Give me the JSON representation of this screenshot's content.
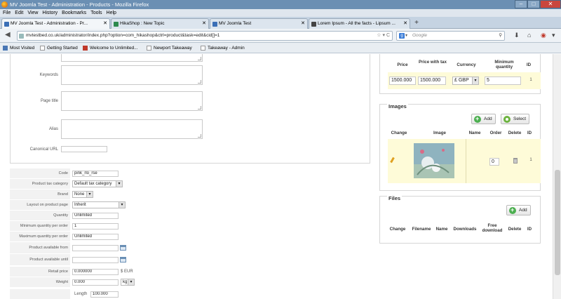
{
  "window": {
    "title": "MV Joomla Test - Administration - Products - Mozilla Firefox",
    "buttons": {
      "minimize": "–",
      "maximize": "□",
      "close": "✕"
    }
  },
  "menu": [
    "File",
    "Edit",
    "View",
    "History",
    "Bookmarks",
    "Tools",
    "Help"
  ],
  "tabs": [
    {
      "label": "MV Joomla Test - Administration - Pr...",
      "close": "✕"
    },
    {
      "label": "HikaShop : New Topic",
      "close": "✕"
    },
    {
      "label": "MV Joomla Test",
      "close": "✕"
    },
    {
      "label": "Lorem Ipsum - All the facts - Lipsum ...",
      "close": "✕"
    }
  ],
  "newtab": "+",
  "nav": {
    "back": "◀",
    "url": "mvtestbed.co.uk/administrator/index.php?option=com_hikashop&ctrl=product&task=edit&cid[]=1",
    "url_controls": "☆ ▾ C",
    "search_placeholder": "Google",
    "search_engine": "g",
    "search_dropdown": "▾",
    "search_glass": "⚲",
    "download_icon": "⬇",
    "home_icon": "⌂",
    "addon_icon": "◉",
    "menu_icon": "▾"
  },
  "bookmarks": [
    "Most Visited",
    "Getting Started",
    "Welcome to Unlimited...",
    "Newport Takeaway",
    "Takeaway - Admin"
  ],
  "seo": {
    "keywords_label": "Keywords",
    "page_title_label": "Page title",
    "alias_label": "Alias",
    "canonical_label": "Canonical URL"
  },
  "properties": {
    "code": {
      "label": "Code",
      "value": "pink_rlo_rse"
    },
    "tax_category": {
      "label": "Product tax category",
      "value": "Default tax category"
    },
    "brand": {
      "label": "Brand",
      "value": "None"
    },
    "layout": {
      "label": "Layout on product page",
      "value": "Inherit"
    },
    "quantity": {
      "label": "Quantity",
      "value": "Unlimited"
    },
    "min_qty": {
      "label": "Minimum quantity per order",
      "value": "1"
    },
    "max_qty": {
      "label": "Maximum quantity per order",
      "value": "Unlimited"
    },
    "available_from": {
      "label": "Product available from",
      "value": ""
    },
    "available_until": {
      "label": "Product available until",
      "value": ""
    },
    "retail_price": {
      "label": "Retail price",
      "value": "0.000000",
      "currency": "$ EUR"
    },
    "weight": {
      "label": "Weight",
      "value": "0.000",
      "unit": "kg"
    },
    "length": {
      "label": "Length",
      "value": "100.000"
    }
  },
  "prices": {
    "headers": [
      "Price",
      "Price with tax",
      "Currency",
      "Minimum quantity",
      "ID"
    ],
    "row": {
      "price": "1500.000",
      "price_tax": "1500.000",
      "currency": "£ GBP",
      "min_qty": "5",
      "id": "1"
    }
  },
  "images": {
    "legend": "Images",
    "add_label": "Add",
    "select_label": "Select",
    "headers": [
      "Change",
      "Image",
      "Name",
      "Order",
      "Delete",
      "ID"
    ],
    "row": {
      "order": "0",
      "id": "1"
    }
  },
  "files": {
    "legend": "Files",
    "add_label": "Add",
    "headers": [
      "Change",
      "Filename",
      "Name",
      "Downloads",
      "Free download",
      "Delete",
      "ID"
    ]
  },
  "colors": {
    "highlight_row": "#fefbd8",
    "titlebar": "#6b8fb3",
    "add_icon": "#4caf50"
  }
}
